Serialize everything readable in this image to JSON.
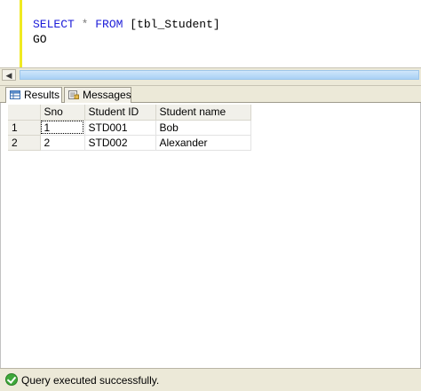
{
  "editor": {
    "line1": {
      "kw1": "SELECT",
      "op": "*",
      "kw2": "FROM",
      "ident": "[tbl_Student]"
    },
    "line2": {
      "kw": "GO"
    }
  },
  "tabs": [
    {
      "label": "Results",
      "icon": "grid-icon",
      "active": true
    },
    {
      "label": "Messages",
      "icon": "messages-icon",
      "active": false
    }
  ],
  "grid": {
    "columns": [
      "Sno",
      "Student ID",
      "Student name"
    ],
    "rows": [
      {
        "num": "1",
        "cells": [
          "1",
          "STD001",
          "Bob"
        ]
      },
      {
        "num": "2",
        "cells": [
          "2",
          "STD002",
          "Alexander"
        ]
      }
    ]
  },
  "status": {
    "text": "Query executed successfully.",
    "icon": "success-check-icon"
  },
  "colors": {
    "keyword": "#1c1cd8",
    "change_bar": "#f0ea22",
    "success": "#3ea83a"
  }
}
